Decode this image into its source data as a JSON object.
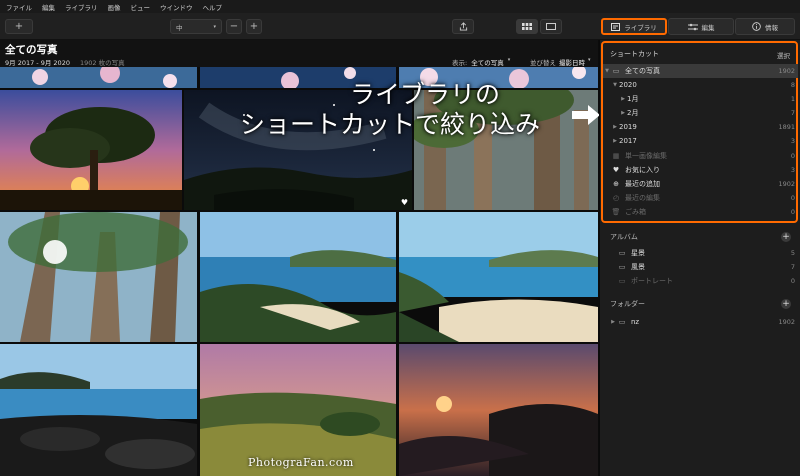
{
  "menu": [
    "ファイル",
    "編集",
    "ライブラリ",
    "画像",
    "ビュー",
    "ウインドウ",
    "ヘルプ"
  ],
  "toolbar": {
    "add_label": "+",
    "zoom_value": "中",
    "zoom_minus": "−",
    "zoom_plus": "+"
  },
  "modes": {
    "library": "ライブラリ",
    "edit": "編集",
    "info": "情報"
  },
  "header": {
    "title": "全ての写真",
    "range": "9月 2017 - 9月 2020",
    "count": "1902 枚の写真",
    "display_label": "表示:",
    "display_value": "全ての写真",
    "sort_label": "並び替え",
    "sort_value": "撮影日時"
  },
  "overlay": {
    "line1": "ライブラリの",
    "line2": "ショートカットで絞り込み"
  },
  "watermark": "PhotograFan.com",
  "shortcuts": {
    "header": "ショートカット",
    "select": "選択",
    "items": [
      {
        "label": "全ての写真",
        "count": "1902",
        "icon": "photos-icon",
        "selected": true,
        "dim": false
      },
      {
        "label": "2020",
        "count": "8",
        "icon": "",
        "selected": false,
        "dim": false
      },
      {
        "label": "1月",
        "count": "1",
        "icon": "",
        "selected": false,
        "dim": false
      },
      {
        "label": "2月",
        "count": "7",
        "icon": "",
        "selected": false,
        "dim": false
      },
      {
        "label": "2019",
        "count": "1891",
        "icon": "",
        "selected": false,
        "dim": false
      },
      {
        "label": "2017",
        "count": "3",
        "icon": "",
        "selected": false,
        "dim": false
      },
      {
        "label": "単一画像編集",
        "count": "0",
        "icon": "grid-icon",
        "selected": false,
        "dim": true
      },
      {
        "label": "お気に入り",
        "count": "3",
        "icon": "heart-icon",
        "selected": false,
        "dim": false
      },
      {
        "label": "最近の追加",
        "count": "1902",
        "icon": "plus-circle-icon",
        "selected": false,
        "dim": false
      },
      {
        "label": "最近の編集",
        "count": "0",
        "icon": "history-icon",
        "selected": false,
        "dim": true
      },
      {
        "label": "ごみ箱",
        "count": "0",
        "icon": "trash-icon",
        "selected": false,
        "dim": true
      }
    ]
  },
  "albums": {
    "header": "アルバム",
    "items": [
      {
        "label": "星景",
        "count": "5",
        "dim": false
      },
      {
        "label": "風景",
        "count": "7",
        "dim": false
      },
      {
        "label": "ポートレート",
        "count": "0",
        "dim": true
      }
    ]
  },
  "folders": {
    "header": "フォルダー",
    "items": [
      {
        "label": "nz",
        "count": "1902"
      }
    ]
  }
}
